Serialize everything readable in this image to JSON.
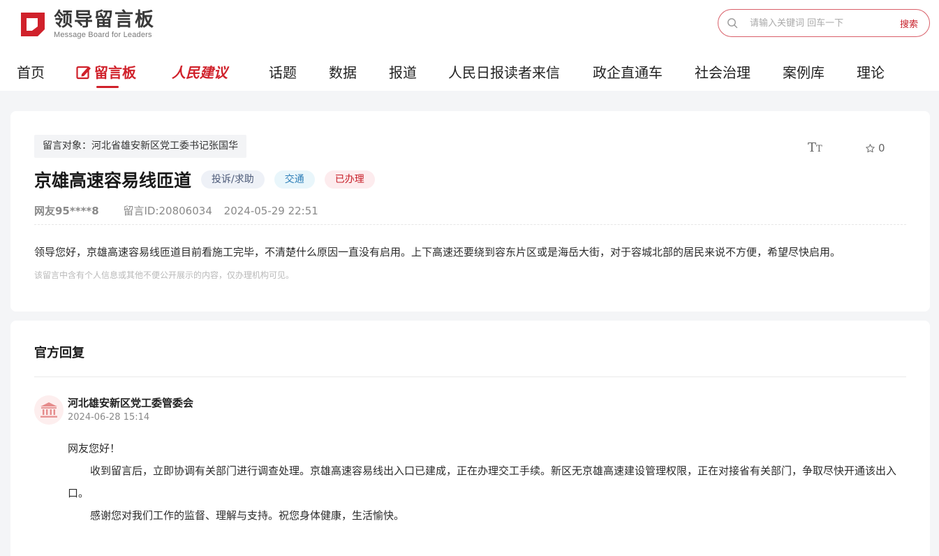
{
  "header": {
    "logo_cn": "领导留言板",
    "logo_en": "Message Board for Leaders",
    "search": {
      "placeholder": "请输入关键词 回车一下",
      "button": "搜索"
    },
    "brand_color": "#d0212b"
  },
  "nav": {
    "items": [
      {
        "label": "首页"
      },
      {
        "label": "留言板",
        "active": true
      },
      {
        "label": "人民建议"
      },
      {
        "label": "话题"
      },
      {
        "label": "数据"
      },
      {
        "label": "报道"
      },
      {
        "label": "人民日报读者来信"
      },
      {
        "label": "政企直通车"
      },
      {
        "label": "社会治理"
      },
      {
        "label": "案例库"
      },
      {
        "label": "理论"
      }
    ]
  },
  "message": {
    "target": "留言对象：河北省雄安新区党工委书记张国华",
    "font_toggle": "TT",
    "favorite_count": "0",
    "title": "京雄高速容易线匝道",
    "badges": {
      "category": "投诉/求助",
      "topic": "交通",
      "status": "已办理"
    },
    "user": "网友95****8",
    "message_id": "留言ID:20806034",
    "datetime": "2024-05-29 22:51",
    "body": "领导您好，京雄高速容易线匝道目前看施工完毕，不清楚什么原因一直没有启用。上下高速还要绕到容东片区或是海岳大街，对于容城北部的居民来说不方便，希望尽快启用。",
    "privacy_note": "该留言中含有个人信息或其他不便公开展示的内容，仅办理机构可见。"
  },
  "reply": {
    "heading": "官方回复",
    "org_icon": "institution-icon",
    "org_name": "河北雄安新区党工委管委会",
    "datetime": "2024-06-28 15:14",
    "greeting": "网友您好！",
    "paragraph1": "收到留言后，立即协调有关部门进行调查处理。京雄高速容易线出入口已建成，正在办理交工手续。新区无京雄高速建设管理权限，正在对接省有关部门，争取尽快开通该出入口。",
    "paragraph2": "感谢您对我们工作的监督、理解与支持。祝您身体健康，生活愉快。"
  }
}
